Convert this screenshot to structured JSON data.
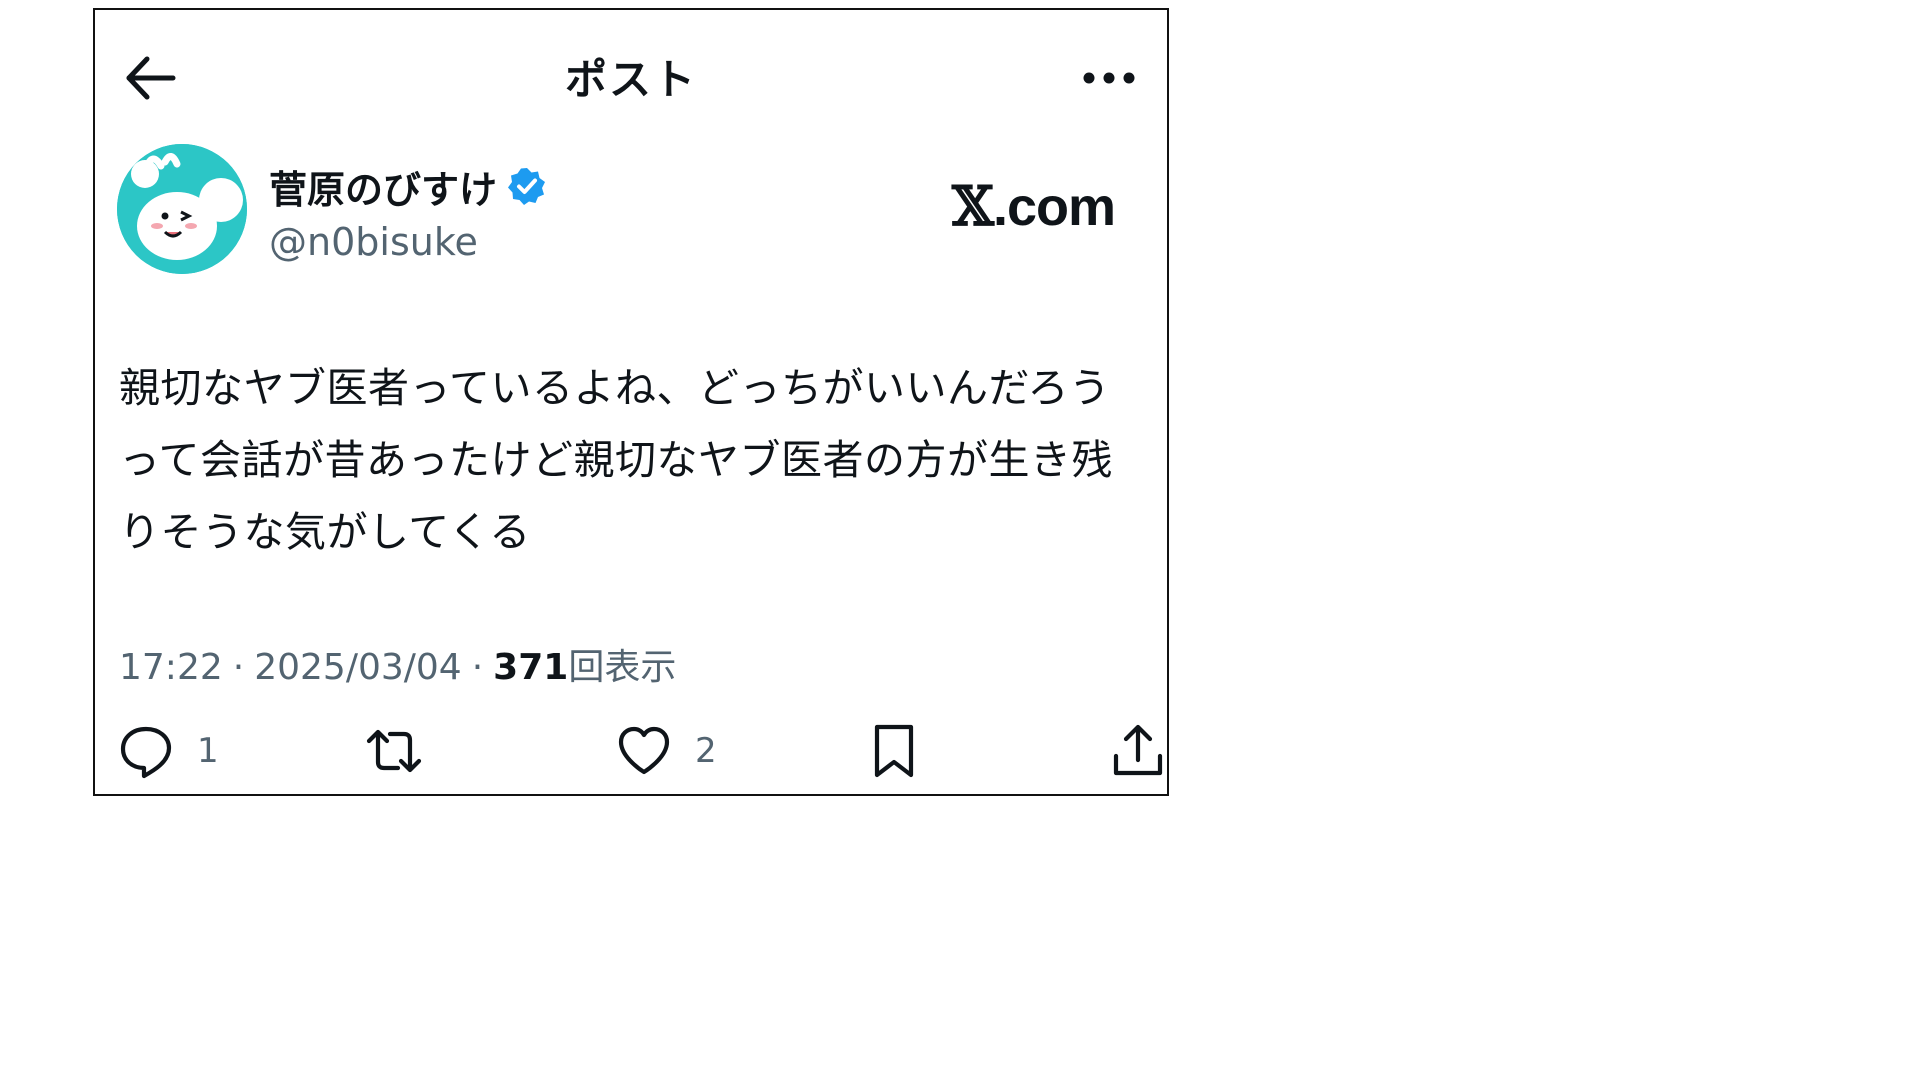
{
  "header": {
    "title": "ポスト",
    "back_icon": "arrow-left-icon",
    "more_icon": "more-horizontal-icon"
  },
  "author": {
    "display_name": "菅原のびすけ",
    "handle": "@n0bisuke",
    "verified": true,
    "verified_color": "#1d9bf0",
    "avatar_color": "#2cc6c6"
  },
  "watermark": {
    "x_char": "𝕏",
    "domain_text": ".com"
  },
  "post": {
    "text": "親切なヤブ医者っているよね、どっちがいいんだろうって会話が昔あったけど親切なヤブ医者の方が生き残りそうな気がしてくる"
  },
  "meta": {
    "time": "17:22",
    "sep1": "·",
    "date": "2025/03/04",
    "sep2": "·",
    "views_count": "371",
    "views_label": "回表示"
  },
  "actions": {
    "reply_icon": "reply-icon",
    "reply_count": "1",
    "repost_icon": "repost-icon",
    "like_icon": "heart-icon",
    "like_count": "2",
    "bookmark_icon": "bookmark-icon",
    "share_icon": "share-icon"
  },
  "colors": {
    "text_primary": "#0f1419",
    "text_secondary": "#536471",
    "border": "#111111"
  }
}
